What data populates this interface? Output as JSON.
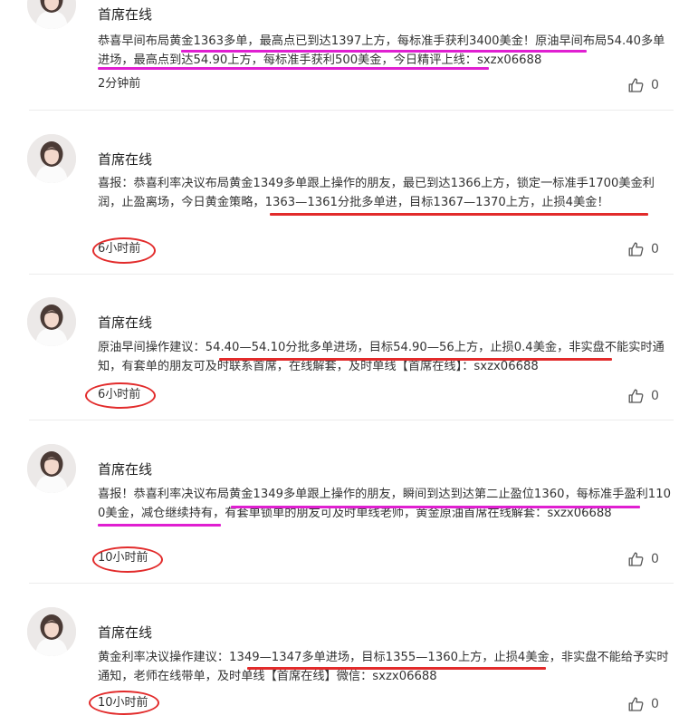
{
  "colors": {
    "underline_red": "#e22b2b",
    "underline_magenta": "#e01fd1",
    "text": "#333333"
  },
  "icons": {
    "avatar": "avatar-photo",
    "like": "thumbs-up-icon"
  },
  "posts": [
    {
      "author": "首席在线",
      "content": "恭喜早间布局黄金1363多单，最高点已到达1397上方，每标准手获利3400美金！原油早间布局54.40多单进场，最高点到达54.90上方，每标准手获利500美金，今日精评上线：sxzx06688",
      "time": "2分钟前",
      "likes": "0"
    },
    {
      "author": "首席在线",
      "content": "喜报：恭喜利率决议布局黄金1349多单跟上操作的朋友，最已到达1366上方，锁定一标准手1700美金利润，止盈离场，今日黄金策略，1363—1361分批多单进，目标1367—1370上方，止损4美金！",
      "time": "6小时前",
      "likes": "0"
    },
    {
      "author": "首席在线",
      "content": "原油早间操作建议：54.40—54.10分批多单进场，目标54.90—56上方，止损0.4美金，非实盘不能实时通知，有套单的朋友可及时联系首席，在线解套，及时单线【首席在线】：sxzx06688",
      "time": "6小时前",
      "likes": "0"
    },
    {
      "author": "首席在线",
      "content": "喜报！恭喜利率决议布局黄金1349多单跟上操作的朋友，瞬间到达到达第二止盈位1360，每标准手盈利1100美金，减仓继续持有，有套单锁单的朋友可及时单线老师，黄金原油首席在线解套：sxzx06688",
      "time": "10小时前",
      "likes": "0"
    },
    {
      "author": "首席在线",
      "content": "黄金利率决议操作建议：1349—1347多单进场，目标1355—1360上方，止损4美金，非实盘不能给予实时通知，老师在线带单，及时单线【首席在线】微信：sxzx06688",
      "time": "10小时前",
      "likes": "0"
    }
  ]
}
